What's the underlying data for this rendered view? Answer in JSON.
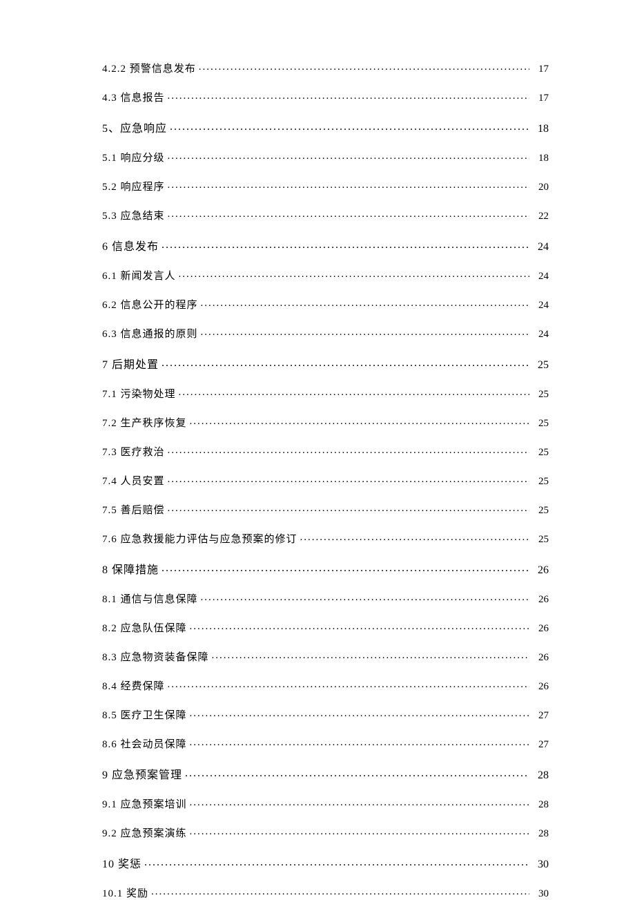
{
  "toc": [
    {
      "level": 2,
      "label": "4.2.2 预警信息发布",
      "page": "17"
    },
    {
      "level": 2,
      "label": "4.3 信息报告",
      "page": "17"
    },
    {
      "level": 1,
      "label": "5、应急响应",
      "page": "18"
    },
    {
      "level": 2,
      "label": "5.1 响应分级",
      "page": "18"
    },
    {
      "level": 2,
      "label": "5.2 响应程序",
      "page": "20"
    },
    {
      "level": 2,
      "label": "5.3 应急结束",
      "page": "22"
    },
    {
      "level": 1,
      "label": "6 信息发布",
      "page": "24"
    },
    {
      "level": 2,
      "label": "6.1 新闻发言人",
      "page": "24"
    },
    {
      "level": 2,
      "label": "6.2 信息公开的程序",
      "page": "24"
    },
    {
      "level": 2,
      "label": "6.3 信息通报的原则",
      "page": "24"
    },
    {
      "level": 1,
      "label": "7 后期处置",
      "page": "25"
    },
    {
      "level": 2,
      "label": "7.1 污染物处理",
      "page": "25"
    },
    {
      "level": 2,
      "label": "7.2 生产秩序恢复",
      "page": "25"
    },
    {
      "level": 2,
      "label": "7.3 医疗救治",
      "page": "25"
    },
    {
      "level": 2,
      "label": "7.4 人员安置",
      "page": "25"
    },
    {
      "level": 2,
      "label": "7.5 善后赔偿",
      "page": "25"
    },
    {
      "level": 2,
      "label": "7.6 应急救援能力评估与应急预案的修订",
      "page": "25"
    },
    {
      "level": 1,
      "label": "8 保障措施",
      "page": "26"
    },
    {
      "level": 2,
      "label": "8.1 通信与信息保障",
      "page": "26"
    },
    {
      "level": 2,
      "label": "8.2 应急队伍保障",
      "page": "26"
    },
    {
      "level": 2,
      "label": "8.3 应急物资装备保障",
      "page": "26"
    },
    {
      "level": 2,
      "label": "8.4 经费保障",
      "page": "26"
    },
    {
      "level": 2,
      "label": "8.5 医疗卫生保障",
      "page": "27"
    },
    {
      "level": 2,
      "label": "8.6 社会动员保障",
      "page": "27"
    },
    {
      "level": 1,
      "label": "9 应急预案管理",
      "page": "28"
    },
    {
      "level": 2,
      "label": "9.1 应急预案培训",
      "page": "28"
    },
    {
      "level": 2,
      "label": "9.2 应急预案演练",
      "page": "28"
    },
    {
      "level": 1,
      "label": "10 奖惩",
      "page": "30"
    },
    {
      "level": 2,
      "label": "10.1 奖励",
      "page": "30"
    }
  ]
}
